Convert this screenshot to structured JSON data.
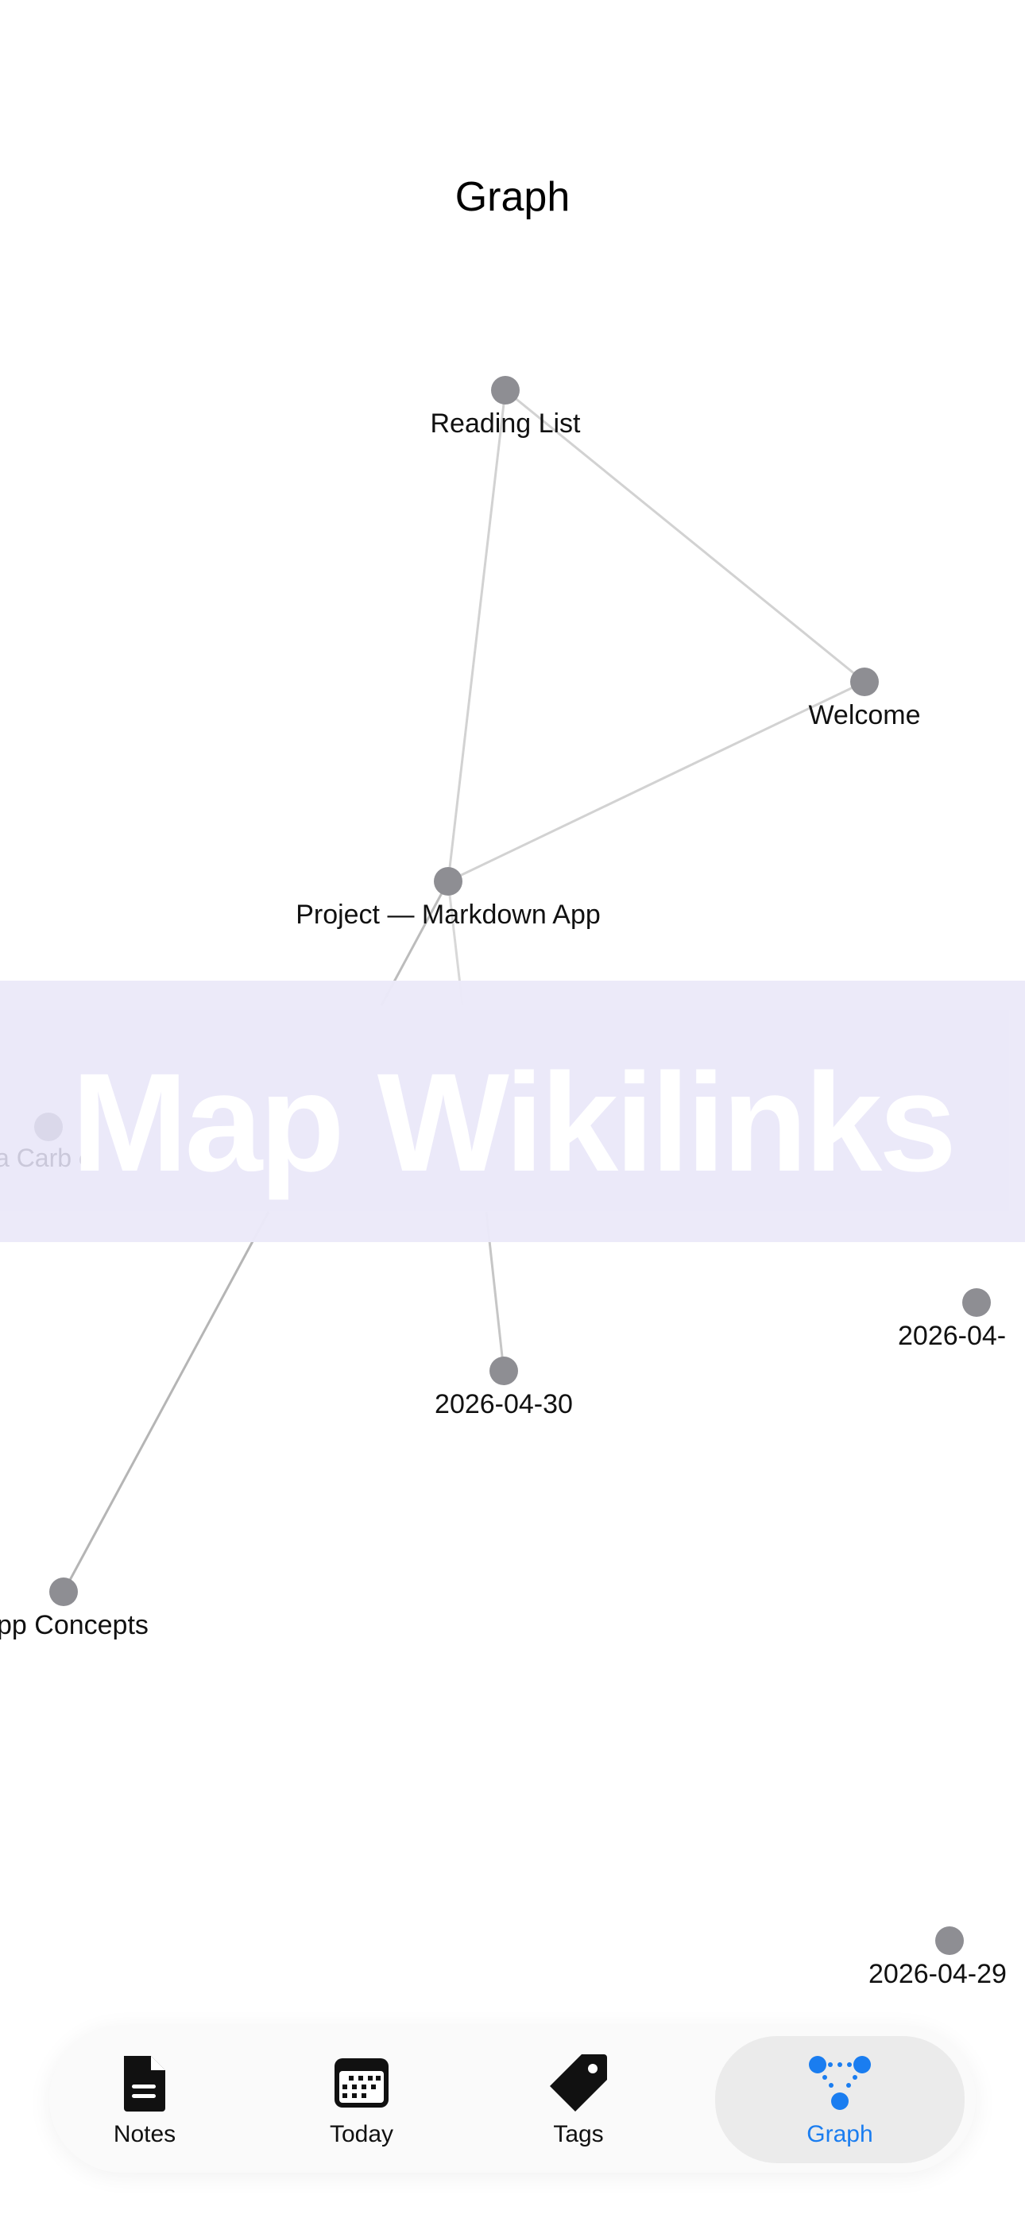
{
  "header": {
    "title": "Graph"
  },
  "graph": {
    "nodes": [
      {
        "id": "reading",
        "label": "Reading List"
      },
      {
        "id": "welcome",
        "label": "Welcome"
      },
      {
        "id": "project",
        "label": "Project — Markdown App"
      },
      {
        "id": "d0430",
        "label": "2026-04-30"
      },
      {
        "id": "d04x",
        "label": "2026-04-"
      },
      {
        "id": "concepts",
        "label": "pp Concepts"
      },
      {
        "id": "d0429",
        "label": "2026-04-29"
      }
    ]
  },
  "overlay": {
    "heading": "Map Wikilinks",
    "faint_label": "a Carb    e"
  },
  "tabbar": {
    "items": [
      {
        "label": "Notes",
        "icon": "note-icon"
      },
      {
        "label": "Today",
        "icon": "calendar-icon"
      },
      {
        "label": "Tags",
        "icon": "tag-icon"
      },
      {
        "label": "Graph",
        "icon": "graph-icon",
        "active": true
      }
    ]
  },
  "colors": {
    "accent": "#1a7df0",
    "node": "#8e8e93",
    "edge": "#cfcfcf"
  }
}
